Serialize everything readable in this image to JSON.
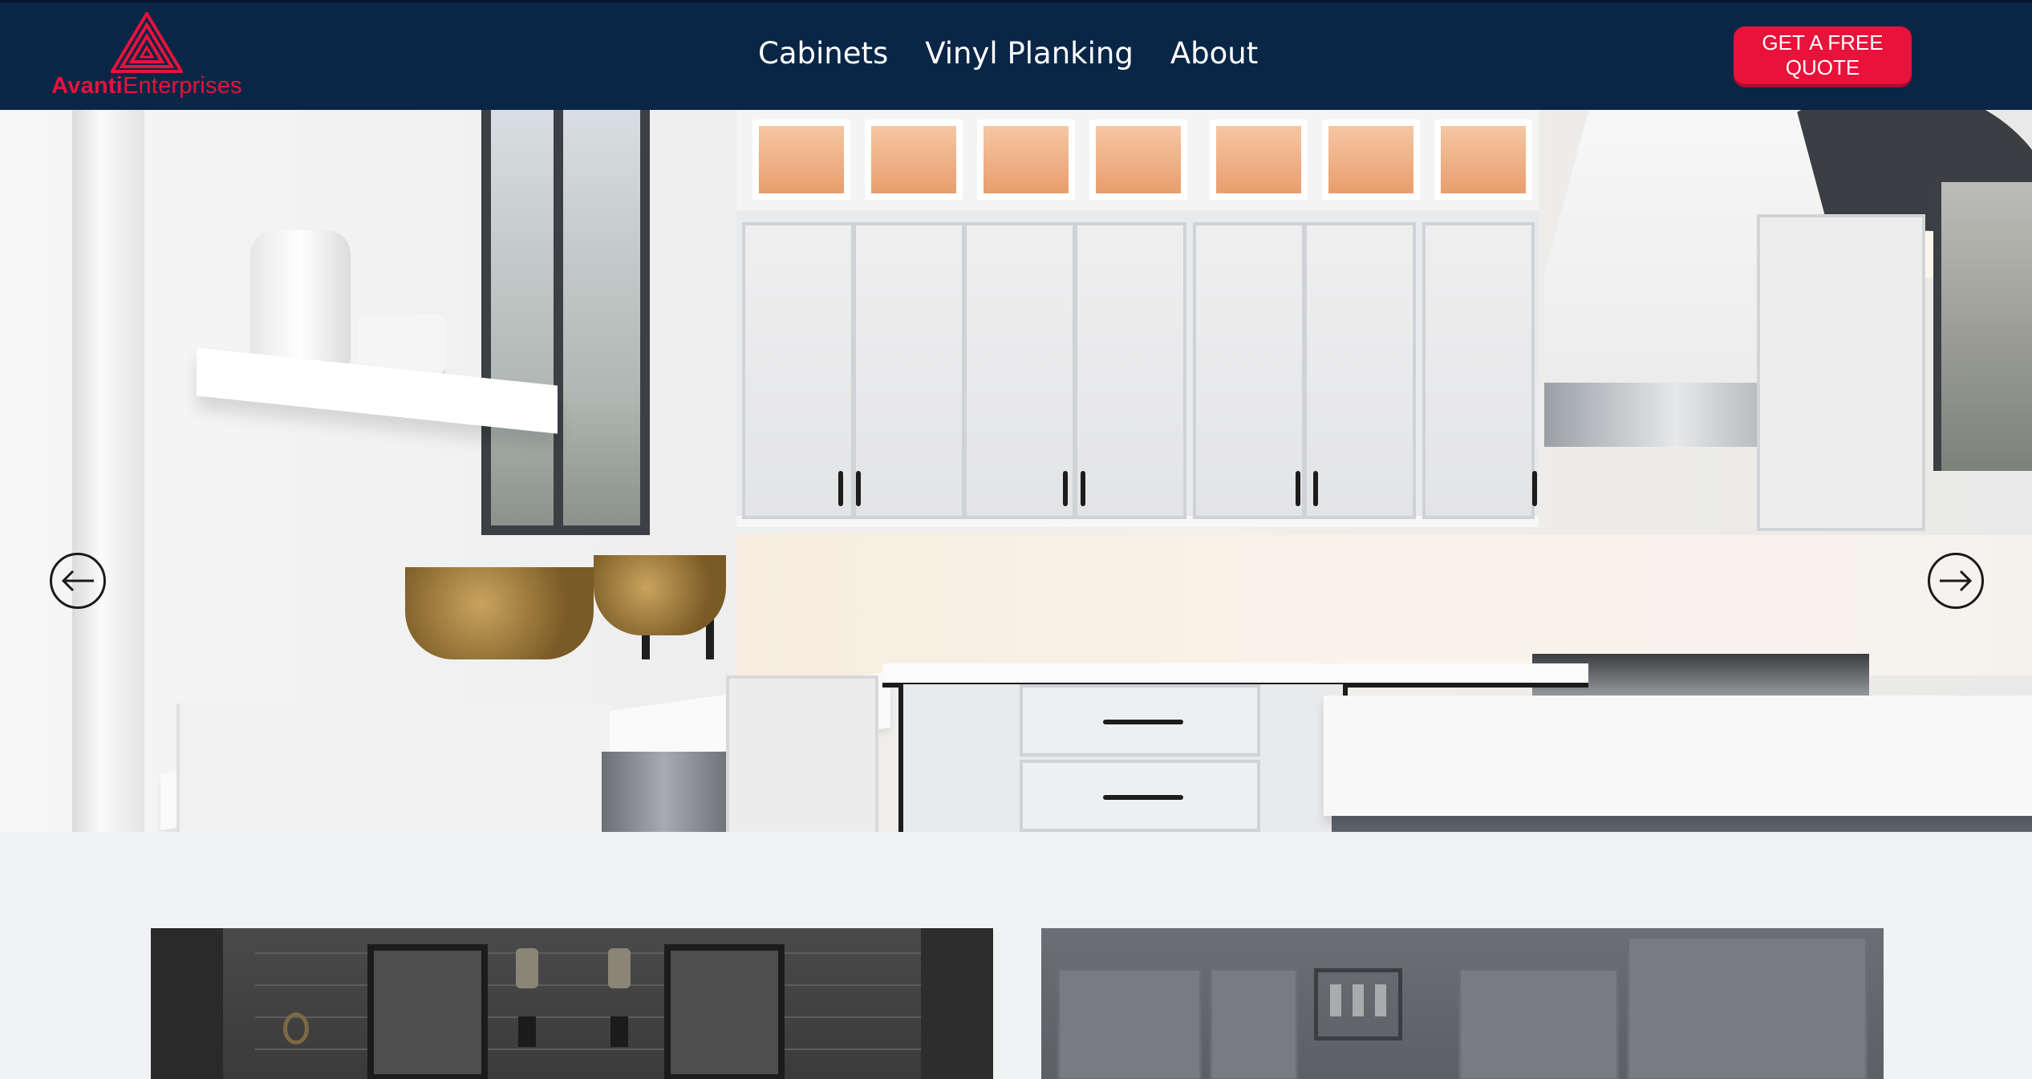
{
  "brand": {
    "name_bold": "Avanti",
    "name_regular": "Enterprises",
    "accent_color": "#e8123b",
    "nav_bg_color": "#0a2647"
  },
  "nav": {
    "items": [
      {
        "label": "Cabinets"
      },
      {
        "label": "Vinyl Planking"
      },
      {
        "label": "About"
      }
    ],
    "cta_label": "GET A FREE QUOTE"
  },
  "hero": {
    "prev_icon": "arrow-left-icon",
    "next_icon": "arrow-right-icon"
  }
}
